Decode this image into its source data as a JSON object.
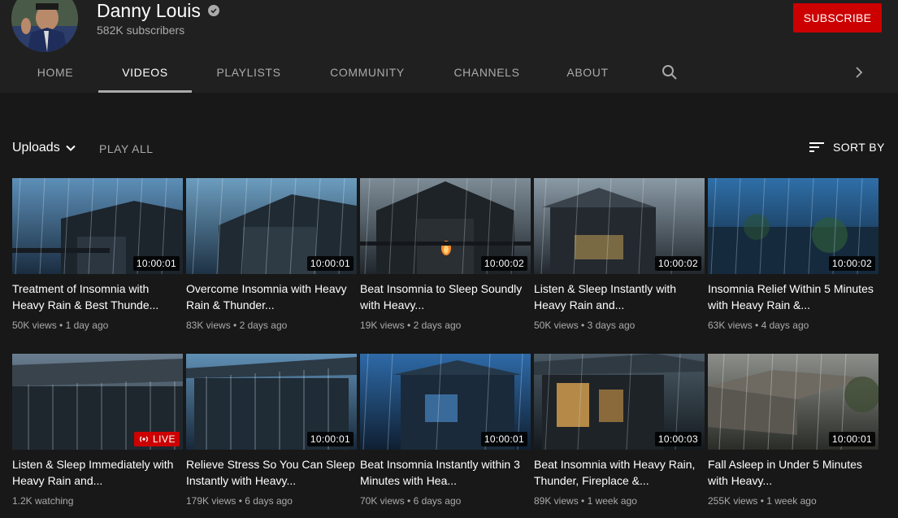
{
  "channel": {
    "name": "Danny Louis",
    "subscribers": "582K subscribers",
    "subscribe_label": "SUBSCRIBE"
  },
  "tabs": [
    {
      "label": "HOME"
    },
    {
      "label": "VIDEOS"
    },
    {
      "label": "PLAYLISTS"
    },
    {
      "label": "COMMUNITY"
    },
    {
      "label": "CHANNELS"
    },
    {
      "label": "ABOUT"
    }
  ],
  "active_tab": "VIDEOS",
  "toolbar": {
    "uploads_label": "Uploads",
    "play_all_label": "PLAY ALL",
    "sort_by_label": "SORT BY"
  },
  "videos": [
    {
      "title": "Treatment of Insomnia with Heavy Rain & Best Thunde...",
      "badge": "10:00:01",
      "views": "50K views",
      "age": "1 day ago"
    },
    {
      "title": "Overcome Insomnia with Heavy Rain & Thunder...",
      "badge": "10:00:01",
      "views": "83K views",
      "age": "2 days ago"
    },
    {
      "title": "Beat Insomnia to Sleep Soundly with Heavy...",
      "badge": "10:00:02",
      "views": "19K views",
      "age": "2 days ago"
    },
    {
      "title": "Listen & Sleep Instantly with Heavy Rain and...",
      "badge": "10:00:02",
      "views": "50K views",
      "age": "3 days ago"
    },
    {
      "title": "Insomnia Relief Within 5 Minutes with Heavy Rain &...",
      "badge": "10:00:02",
      "views": "63K views",
      "age": "4 days ago"
    },
    {
      "title": "Listen & Sleep Immediately with Heavy Rain and...",
      "badge": "LIVE",
      "views": "1.2K watching",
      "age": ""
    },
    {
      "title": "Relieve Stress So You Can Sleep Instantly with Heavy...",
      "badge": "10:00:01",
      "views": "179K views",
      "age": "6 days ago"
    },
    {
      "title": "Beat Insomnia Instantly within 3 Minutes with Hea...",
      "badge": "10:00:01",
      "views": "70K views",
      "age": "6 days ago"
    },
    {
      "title": "Beat Insomnia with Heavy Rain, Thunder, Fireplace &...",
      "badge": "10:00:03",
      "views": "89K views",
      "age": "1 week ago"
    },
    {
      "title": "Fall Asleep in Under 5 Minutes with Heavy...",
      "badge": "10:00:01",
      "views": "255K views",
      "age": "1 week ago"
    }
  ],
  "icons": {
    "verified": "verified-check-icon",
    "search": "search-icon",
    "next": "chevron-right-icon",
    "dropdown": "chevron-down-icon",
    "sort": "sort-icon",
    "live": "live-broadcast-icon"
  },
  "colors": {
    "background": "#181818",
    "header": "#202020",
    "subscribe": "#cc0000",
    "secondary_text": "#aaaaaa"
  }
}
